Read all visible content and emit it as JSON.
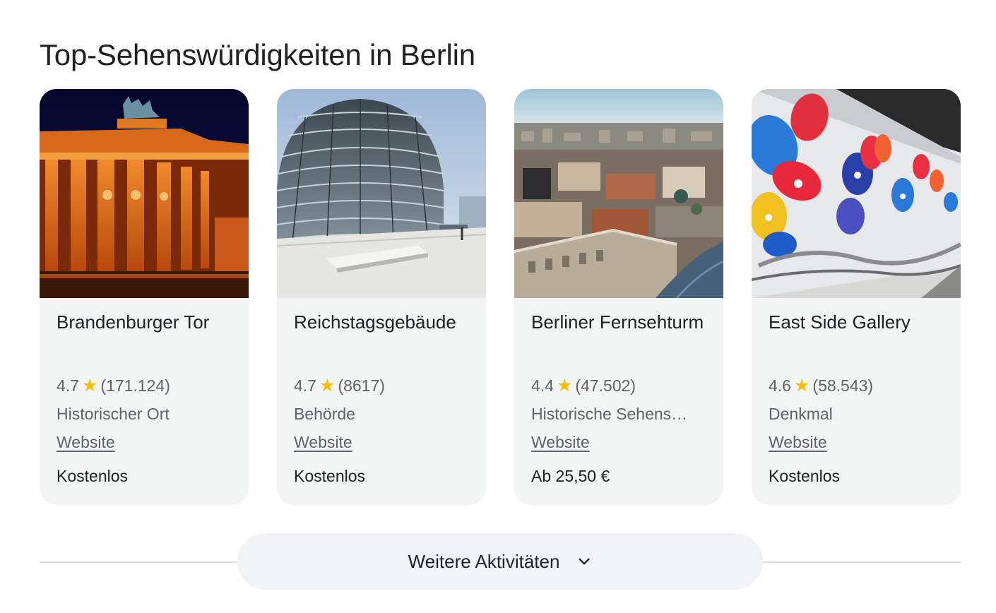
{
  "section": {
    "title": "Top-Sehenswürdigkeiten in Berlin"
  },
  "cards": [
    {
      "name": "Brandenburger Tor",
      "rating": "4.7",
      "reviews": "(171.124)",
      "category": "Historischer Ort",
      "website_label": "Website",
      "price": "Kostenlos",
      "image_icon": "brandenburg-gate-photo"
    },
    {
      "name": "Reichstagsgebäude",
      "rating": "4.7",
      "reviews": "(8617)",
      "category": "Behörde",
      "website_label": "Website",
      "price": "Kostenlos",
      "image_icon": "reichstag-dome-photo"
    },
    {
      "name": "Berliner Fernsehturm",
      "rating": "4.4",
      "reviews": "(47.502)",
      "category": "Historische Sehens…",
      "website_label": "Website",
      "price": "Ab 25,50 €",
      "image_icon": "berlin-skyline-photo"
    },
    {
      "name": "East Side Gallery",
      "rating": "4.6",
      "reviews": "(58.543)",
      "category": "Denkmal",
      "website_label": "Website",
      "price": "Kostenlos",
      "image_icon": "east-side-gallery-mural-photo"
    }
  ],
  "more_button": {
    "label": "Weitere Aktivitäten",
    "icon": "chevron-down-icon"
  },
  "colors": {
    "star": "#fbbc04",
    "card_background": "#f3f4f4",
    "secondary_text": "#5f6368"
  }
}
